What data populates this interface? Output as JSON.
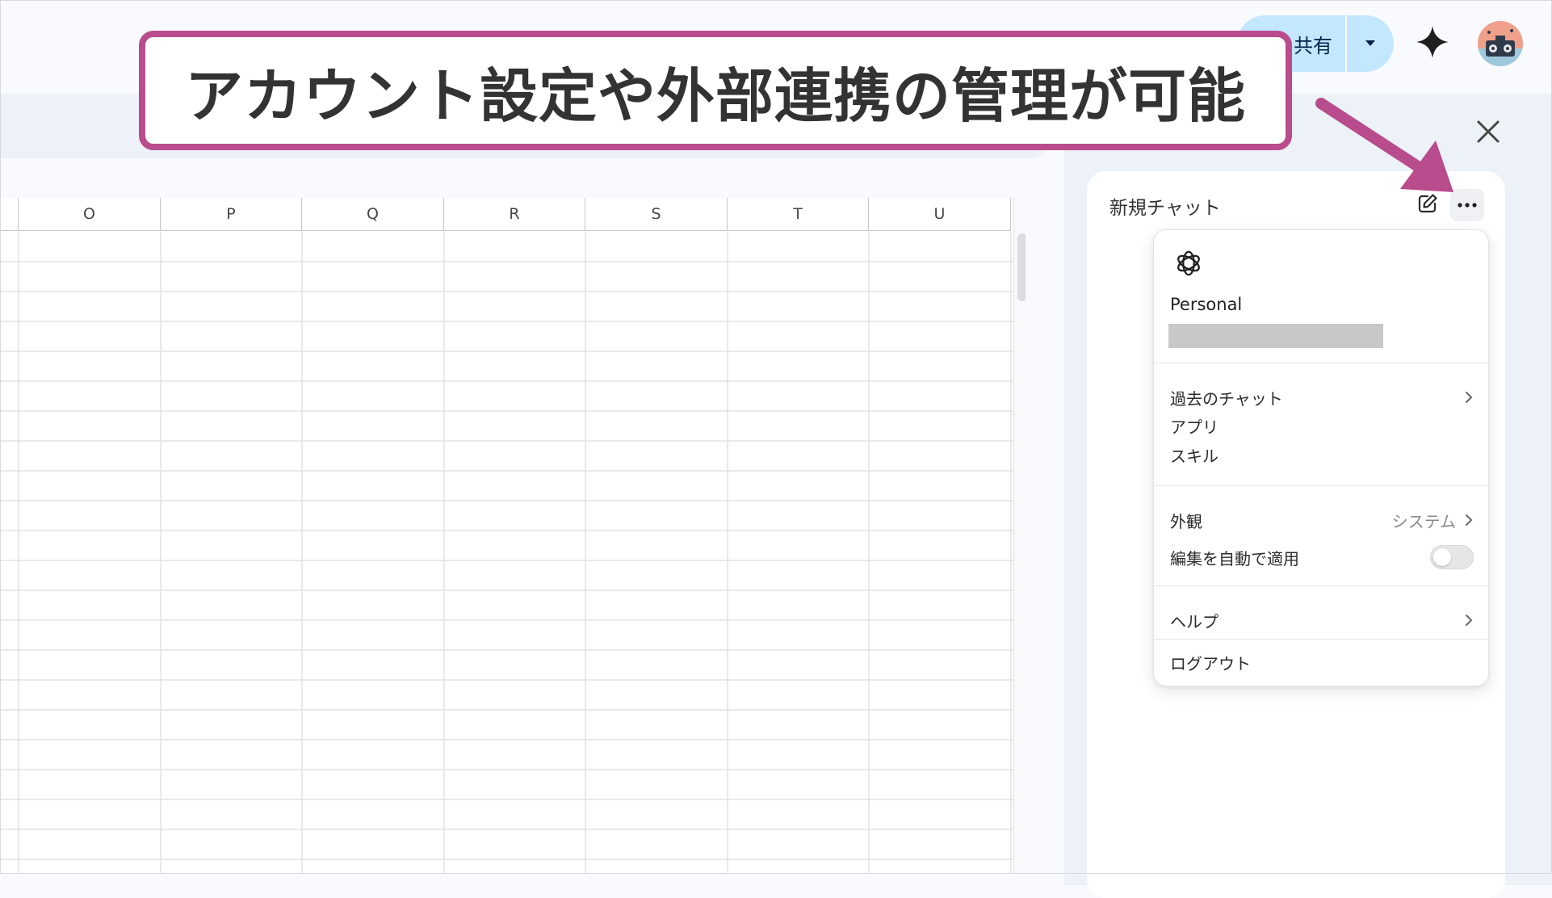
{
  "topbar": {
    "share_label": "共有",
    "sparkle_icon": "sparkle-icon",
    "avatar_icon": "avatar"
  },
  "sheet": {
    "columns": [
      "O",
      "P",
      "Q",
      "R",
      "S",
      "T",
      "U"
    ]
  },
  "callout": {
    "text": "アカウント設定や外部連携の管理が可能",
    "border_color": "#b84c8c"
  },
  "side_panel": {
    "chat_title": "新規チャット",
    "menu": {
      "account_label": "Personal",
      "items_group1": [
        {
          "label": "過去のチャット",
          "chevron": true
        },
        {
          "label": "アプリ",
          "chevron": false
        },
        {
          "label": "スキル",
          "chevron": false
        }
      ],
      "appearance": {
        "label": "外観",
        "value": "システム"
      },
      "auto_apply": {
        "label": "編集を自動で適用",
        "enabled": false
      },
      "help": {
        "label": "ヘルプ"
      },
      "logout": {
        "label": "ログアウト"
      }
    }
  }
}
